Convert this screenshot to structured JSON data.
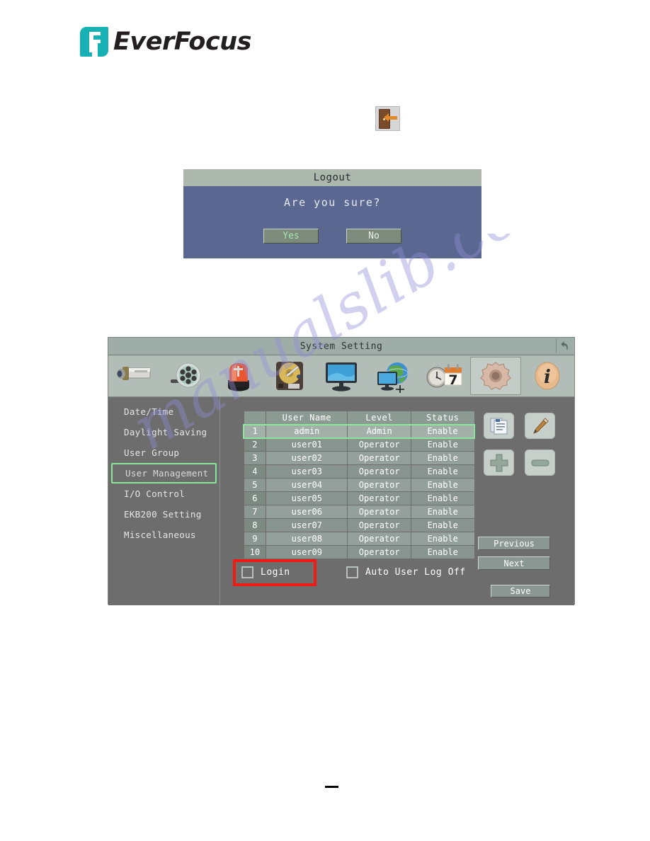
{
  "brand": {
    "name": "EverFocus",
    "mark_color": "#17b0b4",
    "text_color": "#231f20"
  },
  "logout_icon": {
    "name": "logout-door-arrow-icon"
  },
  "logout_dialog": {
    "title": "Logout",
    "question": "Are you sure?",
    "buttons": [
      {
        "label": "Yes",
        "highlighted": true
      },
      {
        "label": "No",
        "highlighted": false
      }
    ],
    "title_bg": "#acb8ac",
    "body_bg": "#5a6891",
    "yes_text_color": "#a8e6b0"
  },
  "system_setting": {
    "title": "System Setting",
    "back_icon": "back-arrow-icon",
    "toolbar_icons": [
      {
        "name": "camera-icon",
        "label": "Camera",
        "selected": false
      },
      {
        "name": "record-reel-icon",
        "label": "Record",
        "selected": false
      },
      {
        "name": "alarm-light-icon",
        "label": "Alarm",
        "selected": false
      },
      {
        "name": "hard-disk-icon",
        "label": "Disk",
        "selected": false
      },
      {
        "name": "monitor-icon",
        "label": "Display",
        "selected": false
      },
      {
        "name": "network-globe-icon",
        "label": "Network",
        "selected": false
      },
      {
        "name": "clock-calendar-icon",
        "label": "Schedule",
        "selected": false
      },
      {
        "name": "gear-icon",
        "label": "System",
        "selected": true
      },
      {
        "name": "info-icon",
        "label": "Information",
        "selected": false
      }
    ],
    "sidebar": {
      "items": [
        {
          "label": "Date/Time",
          "active": false
        },
        {
          "label": "Daylight Saving",
          "active": false
        },
        {
          "label": "User Group",
          "active": false
        },
        {
          "label": "User Management",
          "active": true
        },
        {
          "label": "I/O Control",
          "active": false
        },
        {
          "label": "EKB200 Setting",
          "active": false
        },
        {
          "label": "Miscellaneous",
          "active": false
        }
      ],
      "active_border_color": "#8ae69a"
    },
    "user_table": {
      "columns": [
        "",
        "User Name",
        "Level",
        "Status"
      ],
      "rows": [
        {
          "index": "1",
          "user_name": "admin",
          "level": "Admin",
          "status": "Enable",
          "selected": true
        },
        {
          "index": "2",
          "user_name": "user01",
          "level": "Operator",
          "status": "Enable",
          "selected": false
        },
        {
          "index": "3",
          "user_name": "user02",
          "level": "Operator",
          "status": "Enable",
          "selected": false
        },
        {
          "index": "4",
          "user_name": "user03",
          "level": "Operator",
          "status": "Enable",
          "selected": false
        },
        {
          "index": "5",
          "user_name": "user04",
          "level": "Operator",
          "status": "Enable",
          "selected": false
        },
        {
          "index": "6",
          "user_name": "user05",
          "level": "Operator",
          "status": "Enable",
          "selected": false
        },
        {
          "index": "7",
          "user_name": "user06",
          "level": "Operator",
          "status": "Enable",
          "selected": false
        },
        {
          "index": "8",
          "user_name": "user07",
          "level": "Operator",
          "status": "Enable",
          "selected": false
        },
        {
          "index": "9",
          "user_name": "user08",
          "level": "Operator",
          "status": "Enable",
          "selected": false
        },
        {
          "index": "10",
          "user_name": "user09",
          "level": "Operator",
          "status": "Enable",
          "selected": false
        }
      ]
    },
    "action_buttons": [
      {
        "name": "copy-user-icon"
      },
      {
        "name": "edit-pencil-icon"
      },
      {
        "name": "add-plus-icon"
      },
      {
        "name": "remove-minus-icon"
      }
    ],
    "pagination": {
      "previous_label": "Previous",
      "next_label": "Next"
    },
    "checkboxes": [
      {
        "label": "Login",
        "checked": false,
        "highlighted": true
      },
      {
        "label": "Auto User Log Off",
        "checked": false,
        "highlighted": false
      }
    ],
    "save_label": "Save",
    "highlight_color": "#ee1b12"
  },
  "watermark": {
    "text": "manualslib.com",
    "color": "#8f8fd8"
  }
}
